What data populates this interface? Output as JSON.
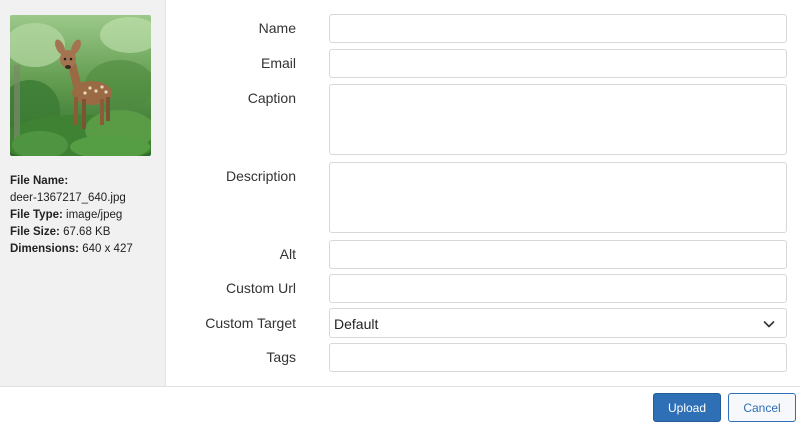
{
  "file_info": {
    "name_label": "File Name:",
    "name_value": "deer-1367217_640.jpg",
    "type_label": "File Type:",
    "type_value": "image/jpeg",
    "size_label": "File Size:",
    "size_value": "67.68 KB",
    "dimensions_label": "Dimensions:",
    "dimensions_value": "640 x 427"
  },
  "form": {
    "name_label": "Name",
    "name_value": "",
    "email_label": "Email",
    "email_value": "",
    "caption_label": "Caption",
    "caption_value": "",
    "description_label": "Description",
    "description_value": "",
    "alt_label": "Alt",
    "alt_value": "",
    "custom_url_label": "Custom Url",
    "custom_url_value": "",
    "custom_target_label": "Custom Target",
    "custom_target_value": "Default",
    "tags_label": "Tags",
    "tags_value": ""
  },
  "footer": {
    "upload_label": "Upload",
    "cancel_label": "Cancel"
  },
  "colors": {
    "primary": "#2f6fb6",
    "sidebar_bg": "#f1f1f1"
  },
  "icons": {
    "select_arrow": "chevron-down-icon"
  }
}
